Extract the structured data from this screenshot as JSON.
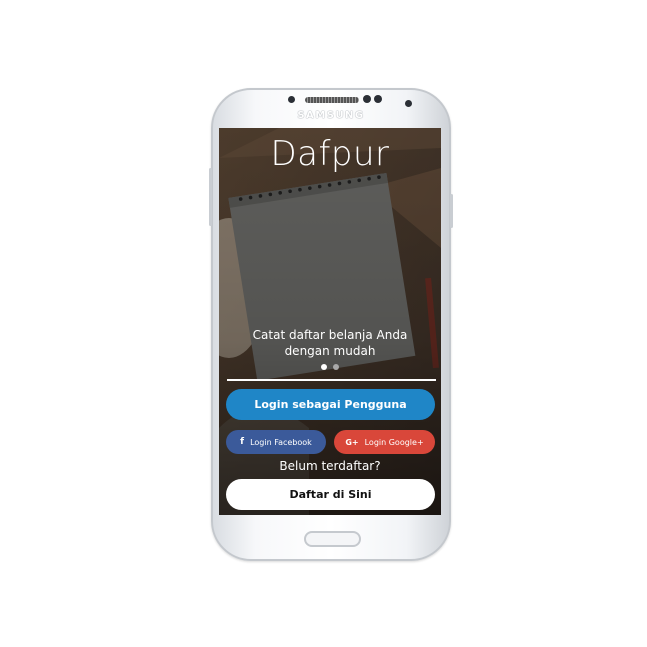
{
  "device": {
    "brand": "SAMSUNG"
  },
  "app": {
    "title": "Dafpur",
    "tagline_line1": "Catat daftar belanja Anda",
    "tagline_line2": "dengan mudah",
    "carousel": {
      "total": 2,
      "active": 1
    },
    "buttons": {
      "login_user": "Login sebagai Pengguna",
      "login_facebook": "Login Facebook",
      "login_google": "Login Google+",
      "register": "Daftar di Sini"
    },
    "icons": {
      "facebook": "facebook-icon",
      "google": "google-plus-icon"
    },
    "not_registered": "Belum terdaftar?"
  },
  "colors": {
    "primary": "#1f86c7",
    "facebook": "#3b5a9a",
    "google": "#d9473a",
    "dot_active": "#ffffff",
    "dot_inactive": "#a8a8a8"
  }
}
